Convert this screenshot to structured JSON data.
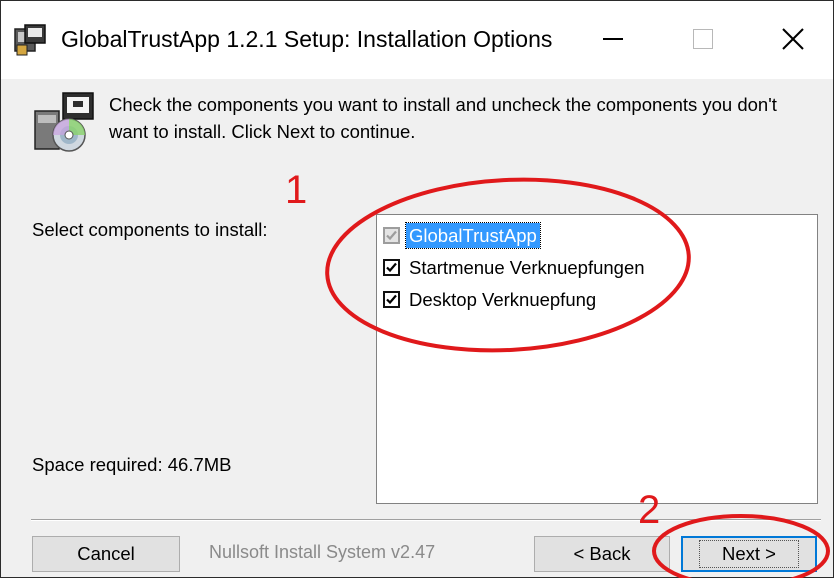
{
  "window": {
    "title": "GlobalTrustApp 1.2.1 Setup: Installation Options",
    "controls": {
      "minimize": "minimize-icon",
      "maximize": "maximize-icon",
      "close": "close-icon"
    }
  },
  "header": {
    "instructions": "Check the components you want to install and uncheck the components you don't want to install. Click Next to continue.",
    "icon": "installer-disk-icon"
  },
  "components": {
    "select_label": "Select components to install:",
    "space_required": "Space required: 46.7MB",
    "items": [
      {
        "label": "GlobalTrustApp",
        "checked": true,
        "disabled": true,
        "selected": true
      },
      {
        "label": "Startmenue Verknuepfungen",
        "checked": true,
        "disabled": false,
        "selected": false
      },
      {
        "label": "Desktop Verknuepfung",
        "checked": true,
        "disabled": false,
        "selected": false
      }
    ]
  },
  "footer": {
    "cancel_label": "Cancel",
    "branding": "Nullsoft Install System v2.47",
    "back_label": "< Back",
    "next_label": "Next >"
  },
  "annotations": {
    "label_1": "1",
    "label_2": "2",
    "color": "#e0191b"
  },
  "colors": {
    "selection": "#3399ff",
    "default_button_border": "#0078d7",
    "window_bg": "#f0f0f0"
  }
}
